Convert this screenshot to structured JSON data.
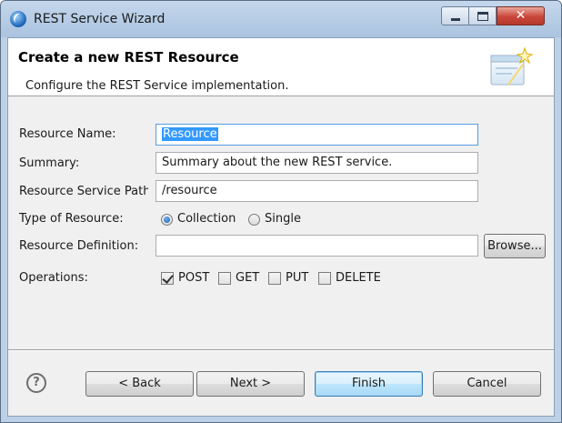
{
  "window": {
    "title": "REST Service Wizard",
    "close_symbol": "✕"
  },
  "banner": {
    "title": "Create a new REST Resource",
    "subtitle": "Configure the REST Service implementation."
  },
  "form": {
    "resource_name": {
      "label": "Resource Name:",
      "value": "Resource"
    },
    "summary": {
      "label": "Summary:",
      "value": "Summary about the new REST service."
    },
    "service_path": {
      "label": "Resource Service Path",
      "value": "/resource"
    },
    "type": {
      "label": "Type of Resource:",
      "options": [
        "Collection",
        "Single"
      ],
      "selected": "Collection"
    },
    "definition": {
      "label": "Resource Definition:",
      "value": "",
      "browse_label": "Browse..."
    },
    "operations": {
      "label": "Operations:",
      "items": [
        {
          "label": "POST",
          "checked": true
        },
        {
          "label": "GET",
          "checked": false
        },
        {
          "label": "PUT",
          "checked": false
        },
        {
          "label": "DELETE",
          "checked": false
        }
      ]
    }
  },
  "buttons": {
    "help": "?",
    "back": "< Back",
    "next": "Next >",
    "finish": "Finish",
    "cancel": "Cancel"
  },
  "colors": {
    "selection": "#3399ff",
    "default_button": "#bee6fd",
    "close_button": "#c9463a"
  },
  "icons": {
    "app": "eclipse-icon",
    "banner": "wizard-banner-icon",
    "help": "help-icon"
  }
}
